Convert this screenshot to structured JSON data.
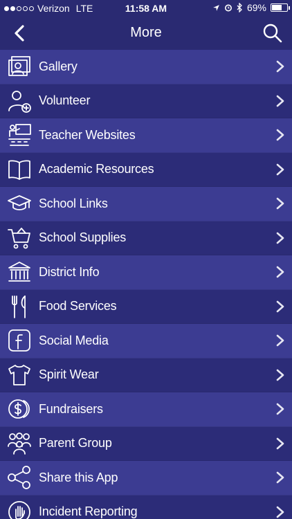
{
  "status": {
    "carrier": "Verizon",
    "network": "LTE",
    "time": "11:58 AM",
    "battery": "69%",
    "battery_level": 0.69,
    "signal_bars": 2
  },
  "nav": {
    "title": "More",
    "back_icon": "chevron-left-icon",
    "search_icon": "search-icon"
  },
  "menu": {
    "items": [
      {
        "label": "Gallery",
        "icon": "gallery-icon"
      },
      {
        "label": "Volunteer",
        "icon": "add-person-icon"
      },
      {
        "label": "Teacher Websites",
        "icon": "teacher-icon"
      },
      {
        "label": "Academic Resources",
        "icon": "book-icon"
      },
      {
        "label": "School Links",
        "icon": "graduation-cap-icon"
      },
      {
        "label": "School Supplies",
        "icon": "cart-icon"
      },
      {
        "label": "District Info",
        "icon": "building-icon"
      },
      {
        "label": "Food Services",
        "icon": "fork-knife-icon"
      },
      {
        "label": "Social Media",
        "icon": "facebook-icon"
      },
      {
        "label": "Spirit Wear",
        "icon": "tshirt-icon"
      },
      {
        "label": "Fundraisers",
        "icon": "dollar-coin-icon"
      },
      {
        "label": "Parent Group",
        "icon": "group-icon"
      },
      {
        "label": "Share this App",
        "icon": "share-icon"
      },
      {
        "label": "Incident Reporting",
        "icon": "hand-icon"
      }
    ]
  },
  "colors": {
    "header": "#2a2a72",
    "row_light": "#3c3c92",
    "row_dark": "#2c2c78"
  }
}
